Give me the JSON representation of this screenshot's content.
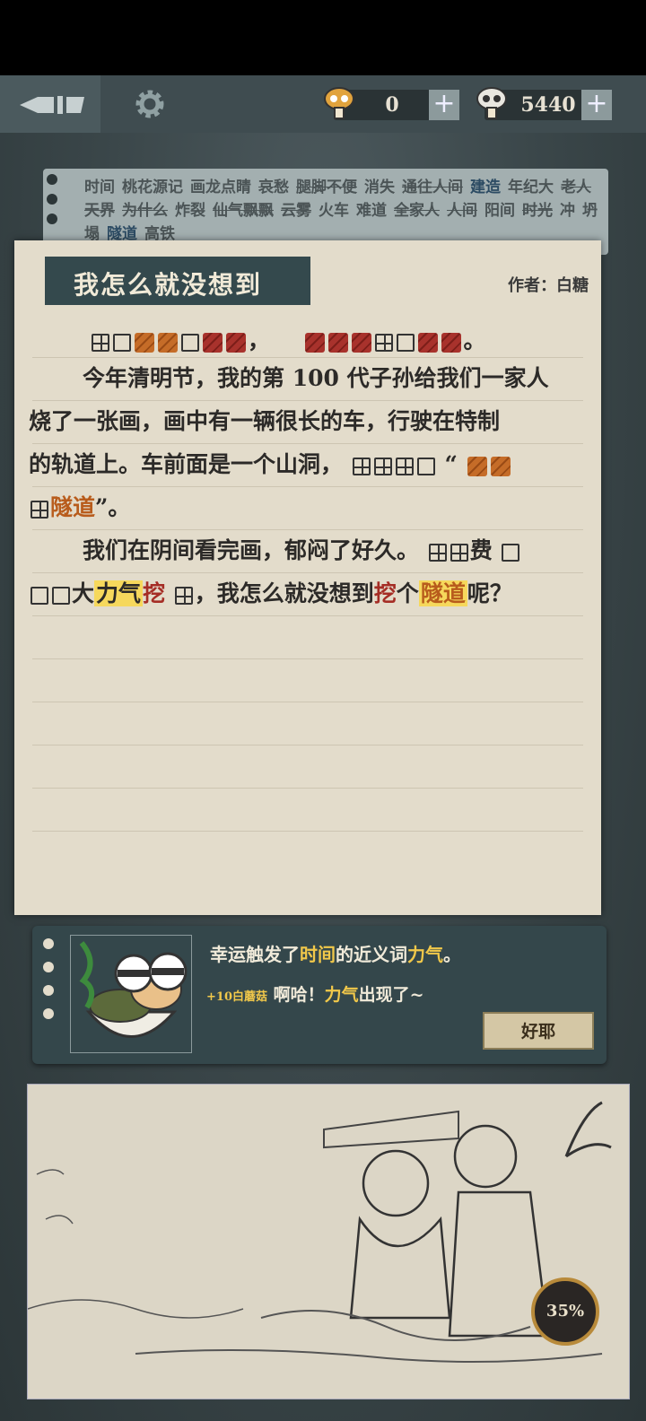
{
  "topbar": {
    "mushroom_orange_count": "0",
    "mushroom_white_count": "5440",
    "plus": "+"
  },
  "wordstrip": {
    "words": [
      {
        "text": "时间",
        "style": "normal"
      },
      {
        "text": "桃花源记",
        "style": "normal"
      },
      {
        "text": "画龙点睛",
        "style": "normal"
      },
      {
        "text": "哀愁",
        "style": "strike"
      },
      {
        "text": "腿脚不便",
        "style": "strike"
      },
      {
        "text": "消失",
        "style": "normal"
      },
      {
        "text": "通往人间",
        "style": "strike"
      },
      {
        "text": "建造",
        "style": "blue"
      },
      {
        "text": "年纪大",
        "style": "normal"
      },
      {
        "text": "老人",
        "style": "strike"
      },
      {
        "text": "天界",
        "style": "strike"
      },
      {
        "text": "为什么",
        "style": "strike"
      },
      {
        "text": "炸裂",
        "style": "normal"
      },
      {
        "text": "仙气飘飘",
        "style": "strike"
      },
      {
        "text": "云雾",
        "style": "strike"
      },
      {
        "text": "火车",
        "style": "normal"
      },
      {
        "text": "难道",
        "style": "normal"
      },
      {
        "text": "全家人",
        "style": "strike"
      },
      {
        "text": "人间",
        "style": "strike"
      },
      {
        "text": "阳间",
        "style": "normal"
      },
      {
        "text": "时光",
        "style": "strike"
      },
      {
        "text": "冲",
        "style": "normal"
      },
      {
        "text": "坍塌",
        "style": "normal"
      },
      {
        "text": "隧道",
        "style": "blue"
      },
      {
        "text": "高铁",
        "style": "normal"
      }
    ]
  },
  "story": {
    "title": "我怎么就没想到",
    "author": "作者：白糖",
    "line1_comma": "，",
    "line1_period": "。",
    "line2": "今年清明节，我的第 100 代子孙给我们一家人",
    "line3": "烧了一张画，画中有一辆很长的车，行驶在特制",
    "line4_a": "的轨道上。车前面是一个山洞，",
    "line4_quote": "“",
    "line5_word": "隧道",
    "line5_end": "”。",
    "line6_a": "我们在阴间看完画，郁闷了好久。",
    "line6_b": "费",
    "line7_a": "大",
    "line7_hl": "力气",
    "line7_red1": "挖",
    "line7_b": "，我怎么就没想到",
    "line7_red2": "挖",
    "line7_c": "个",
    "line7_hl2": "隧道",
    "line7_d": "呢？"
  },
  "notice": {
    "l1_a": "幸运触发了",
    "l1_word1": "时间",
    "l1_b": "的近义词",
    "l1_word2": "力气",
    "l1_end": "。",
    "bonus": "+10白蘑菇",
    "l2_a": " 啊哈！",
    "l2_word": "力气",
    "l2_b": "出现了~",
    "ok_label": "好耶"
  },
  "progress": "35%",
  "colors": {
    "accent_yellow": "#f1c84a",
    "banner": "#34494d"
  }
}
